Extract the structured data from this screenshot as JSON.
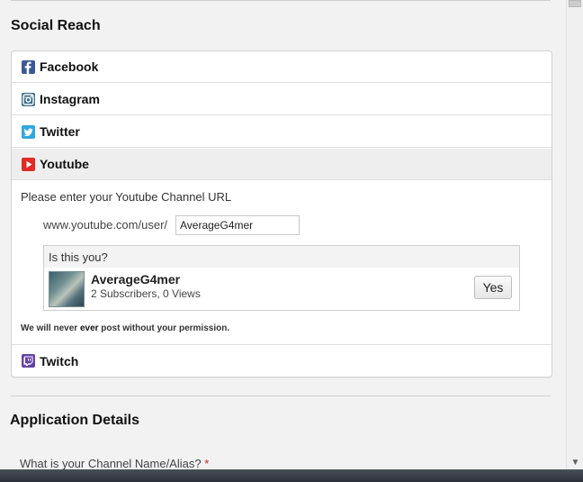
{
  "social_reach": {
    "title": "Social Reach",
    "accounts": [
      {
        "label": "Facebook",
        "icon": "facebook-icon"
      },
      {
        "label": "Instagram",
        "icon": "instagram-icon"
      },
      {
        "label": "Twitter",
        "icon": "twitter-icon"
      },
      {
        "label": "Youtube",
        "icon": "youtube-icon",
        "expanded": true
      },
      {
        "label": "Twitch",
        "icon": "twitch-icon"
      }
    ],
    "youtube": {
      "prompt": "Please enter your Youtube Channel URL",
      "url_prefix": "www.youtube.com/user/",
      "url_value": "AverageG4mer",
      "verify_question": "Is this you?",
      "channel_name": "AverageG4mer",
      "channel_stats": "2 Subscribers, 0 Views",
      "confirm_label": "Yes",
      "disclaimer_pre": "We will never ",
      "disclaimer_emph": "ever",
      "disclaimer_post": " post without your permission."
    }
  },
  "application_details": {
    "title": "Application Details",
    "channel_name_label": "What is your Channel Name/Alias?",
    "required_marker": "*"
  },
  "colors": {
    "facebook": "#3b5998",
    "twitter": "#2fa8e0",
    "youtube": "#e12b26",
    "twitch": "#6441a5",
    "required": "#d02020"
  }
}
